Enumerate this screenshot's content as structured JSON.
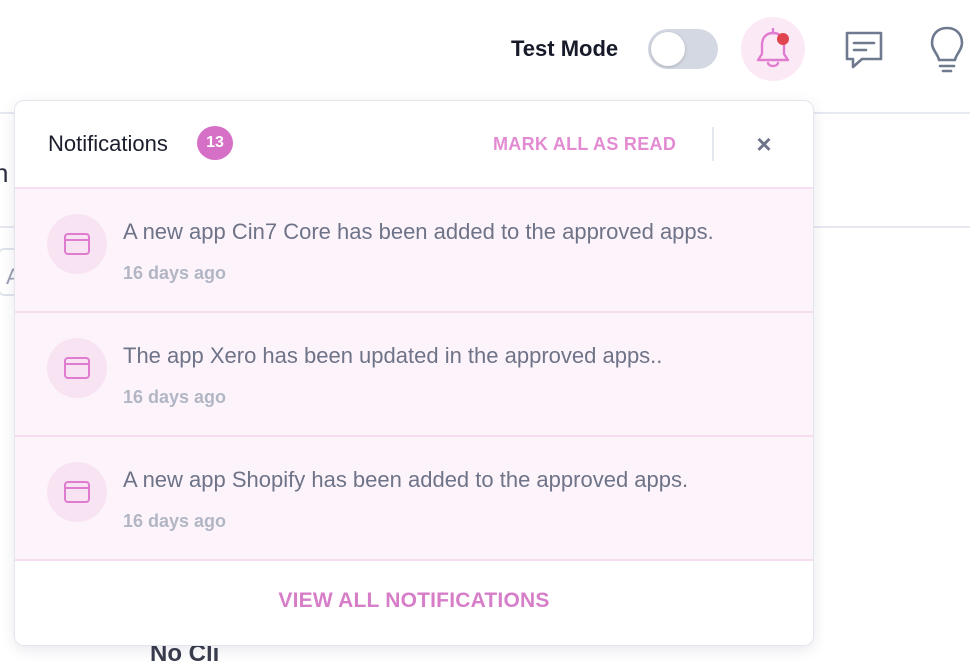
{
  "header": {
    "test_mode_label": "Test Mode",
    "test_mode_enabled": false,
    "icons": [
      "bell-icon",
      "chat-icon",
      "lightbulb-icon"
    ],
    "bell_has_unread_dot": true
  },
  "background": {
    "fragment_1": "n",
    "fragment_2": "A",
    "fragment_3": "No Cli"
  },
  "notifications": {
    "title": "Notifications",
    "count": "13",
    "mark_all_label": "MARK ALL AS READ",
    "close_label": "×",
    "items": [
      {
        "message": "A new app Cin7 Core has been added to the approved apps.",
        "time": "16 days ago",
        "icon": "app-window-icon"
      },
      {
        "message": "The app Xero has been updated in the approved apps..",
        "time": "16 days ago",
        "icon": "app-window-icon"
      },
      {
        "message": "A new app Shopify has been added to the approved apps.",
        "time": "16 days ago",
        "icon": "app-window-icon"
      }
    ],
    "view_all_label": "VIEW ALL NOTIFICATIONS"
  },
  "colors": {
    "accent": "#d66fc6",
    "accent_light": "#fdf4fb",
    "unread_dot": "#e0454f"
  }
}
